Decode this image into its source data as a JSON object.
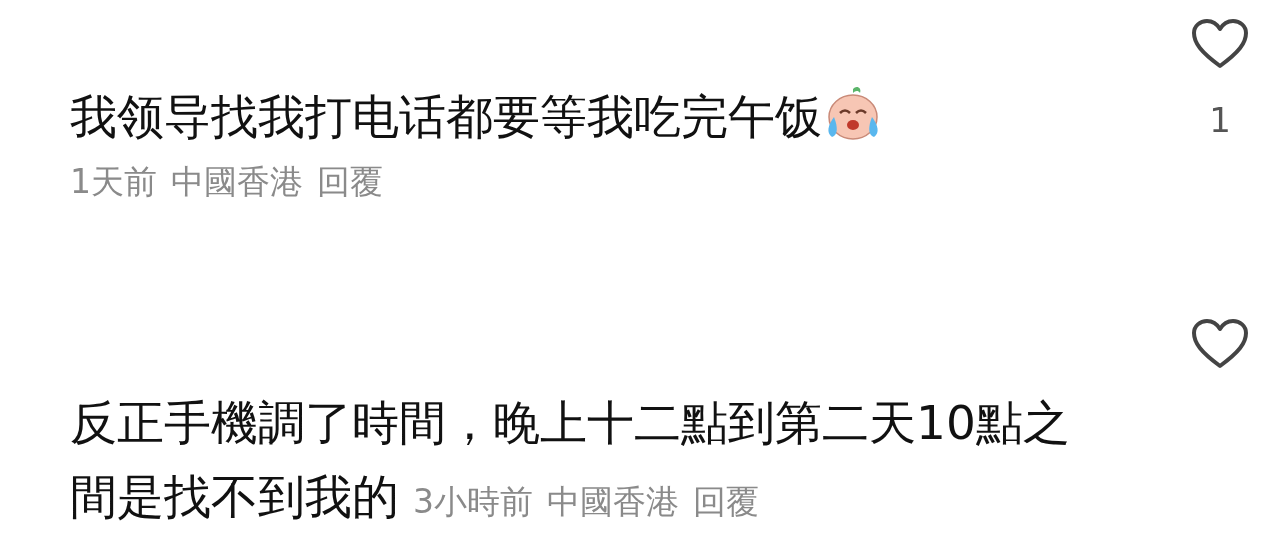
{
  "comments": [
    {
      "text_lines": [
        "我领导找我打电话都要等我吃完午饭"
      ],
      "emoji": true,
      "time": "1天前",
      "location": "中國香港",
      "reply": "回覆",
      "liked": false,
      "like_count": "1"
    },
    {
      "text_lines": [
        "反正手機調了時間，晚上十二點到第二天10點之",
        "間是找不到我的"
      ],
      "emoji": false,
      "time": "3小時前",
      "location": "中國香港",
      "reply": "回覆",
      "liked": false
    }
  ]
}
